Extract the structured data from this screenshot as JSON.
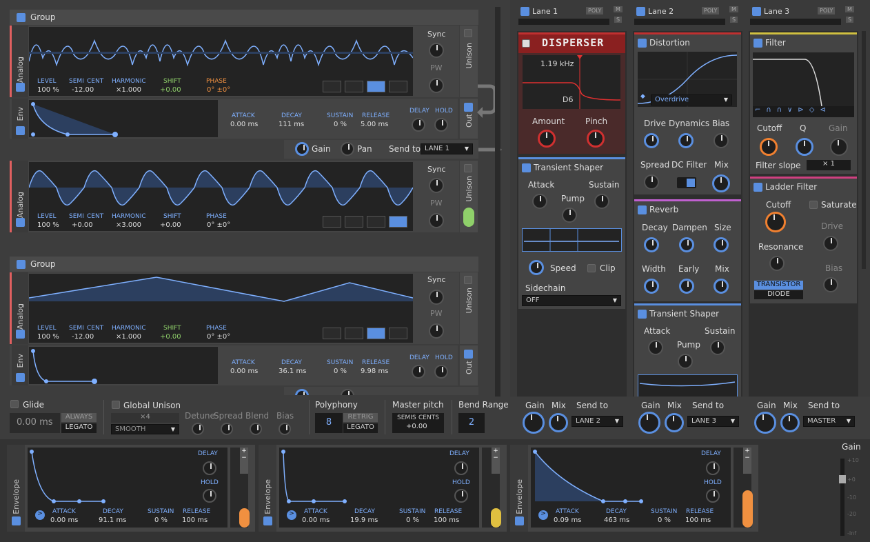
{
  "osc_group1": {
    "title": "Group",
    "osc1": {
      "tab": "Analog",
      "labels": [
        "LEVEL",
        "SEMI",
        "CENT",
        "HARMONIC",
        "SHIFT",
        "PHASE"
      ],
      "values": [
        "100 %",
        "-12.00",
        "×1.000",
        "+0.00",
        "0° ±0°"
      ]
    },
    "env": {
      "tab": "Env",
      "attack_l": "ATTACK",
      "attack": "0.00 ms",
      "decay_l": "DECAY",
      "decay": "111 ms",
      "sustain_l": "SUSTAIN",
      "sustain": "0 %",
      "release_l": "RELEASE",
      "release": "5.00 ms",
      "delay_l": "DELAY",
      "hold_l": "HOLD",
      "out": "Out"
    },
    "gain": "Gain",
    "pan": "Pan",
    "send_to": "Send to",
    "send_val": "LANE 1",
    "osc2": {
      "tab": "Analog",
      "values": [
        "100 %",
        "+0.00",
        "×3.000",
        "+0.00",
        "0° ±0°"
      ]
    },
    "sync": "Sync",
    "pw": "PW",
    "unison": "Unison"
  },
  "osc_group2": {
    "title": "Group",
    "osc": {
      "tab": "Analog",
      "values": [
        "100 %",
        "-12.00",
        "×1.000",
        "+0.00",
        "0° ±0°"
      ]
    },
    "env": {
      "tab": "Env",
      "attack": "0.00 ms",
      "decay": "36.1 ms",
      "sustain": "0 %",
      "release": "9.98 ms",
      "out": "Out"
    }
  },
  "lanes": [
    {
      "name": "Lane 1",
      "poly": "POLY",
      "m": "M",
      "s": "S"
    },
    {
      "name": "Lane 2",
      "poly": "POLY",
      "m": "M",
      "s": "S"
    },
    {
      "name": "Lane 3",
      "poly": "POLY",
      "m": "M",
      "s": "S"
    }
  ],
  "disperser": {
    "title": "DISPERSER",
    "freq": "1.19 kHz",
    "note": "D6",
    "amount": "Amount",
    "pinch": "Pinch"
  },
  "ts1": {
    "title": "Transient Shaper",
    "attack": "Attack",
    "pump": "Pump",
    "sustain": "Sustain",
    "speed": "Speed",
    "clip": "Clip",
    "sidechain": "Sidechain",
    "sc_val": "OFF"
  },
  "distortion": {
    "title": "Distortion",
    "mode": "Overdrive",
    "drive": "Drive",
    "dynamics": "Dynamics",
    "bias": "Bias",
    "spread": "Spread",
    "dcfilter": "DC Filter",
    "mix": "Mix"
  },
  "reverb": {
    "title": "Reverb",
    "decay": "Decay",
    "dampen": "Dampen",
    "size": "Size",
    "width": "Width",
    "early": "Early",
    "mix": "Mix"
  },
  "ts2": {
    "title": "Transient Shaper",
    "attack": "Attack",
    "pump": "Pump",
    "sustain": "Sustain"
  },
  "filter": {
    "title": "Filter",
    "cutoff": "Cutoff",
    "q": "Q",
    "gain": "Gain",
    "slope_l": "Filter slope",
    "slope": "× 1"
  },
  "ladder": {
    "title": "Ladder Filter",
    "cutoff": "Cutoff",
    "saturate": "Saturate",
    "drive": "Drive",
    "resonance": "Resonance",
    "bias": "Bias",
    "transistor": "TRANSISTOR",
    "diode": "DIODE"
  },
  "lane_out": [
    {
      "gain": "Gain",
      "mix": "Mix",
      "send": "Send to",
      "val": "LANE 2"
    },
    {
      "gain": "Gain",
      "mix": "Mix",
      "send": "Send to",
      "val": "LANE 3"
    },
    {
      "gain": "Gain",
      "mix": "Mix",
      "send": "Send to",
      "val": "MASTER"
    }
  ],
  "glide": {
    "title": "Glide",
    "value": "0.00 ms",
    "always": "ALWAYS",
    "legato": "LEGATO"
  },
  "gunison": {
    "title": "Global Unison",
    "voices": "×4",
    "mode": "SMOOTH",
    "detune": "Detune",
    "spread": "Spread",
    "blend": "Blend",
    "bias": "Bias"
  },
  "poly": {
    "title": "Polyphony",
    "value": "8",
    "retrig": "RETRIG",
    "legato": "LEGATO"
  },
  "pitch": {
    "title": "Master pitch",
    "semis": "SEMIS",
    "cents": "CENTS",
    "value": "+0.00"
  },
  "bend": {
    "title": "Bend Range",
    "value": "2"
  },
  "envs": [
    {
      "tab": "Envelope",
      "delay": "DELAY",
      "hold": "HOLD",
      "attack_l": "ATTACK",
      "attack": "0.00 ms",
      "decay_l": "DECAY",
      "decay": "91.1 ms",
      "sustain_l": "SUSTAIN",
      "sustain": "0 %",
      "release_l": "RELEASE",
      "release": "100 ms"
    },
    {
      "tab": "Envelope",
      "delay": "DELAY",
      "hold": "HOLD",
      "attack_l": "ATTACK",
      "attack": "0.00 ms",
      "decay_l": "DECAY",
      "decay": "19.9 ms",
      "sustain_l": "SUSTAIN",
      "sustain": "0 %",
      "release_l": "RELEASE",
      "release": "100 ms"
    },
    {
      "tab": "Envelope",
      "delay": "DELAY",
      "hold": "HOLD",
      "attack_l": "ATTACK",
      "attack": "0.09 ms",
      "decay_l": "DECAY",
      "decay": "463 ms",
      "sustain_l": "SUSTAIN",
      "sustain": "0 %",
      "release_l": "RELEASE",
      "release": "100 ms"
    }
  ],
  "master": {
    "gain": "Gain",
    "ticks": [
      "+10",
      "+0",
      "-10",
      "-20",
      "-Inf"
    ]
  }
}
